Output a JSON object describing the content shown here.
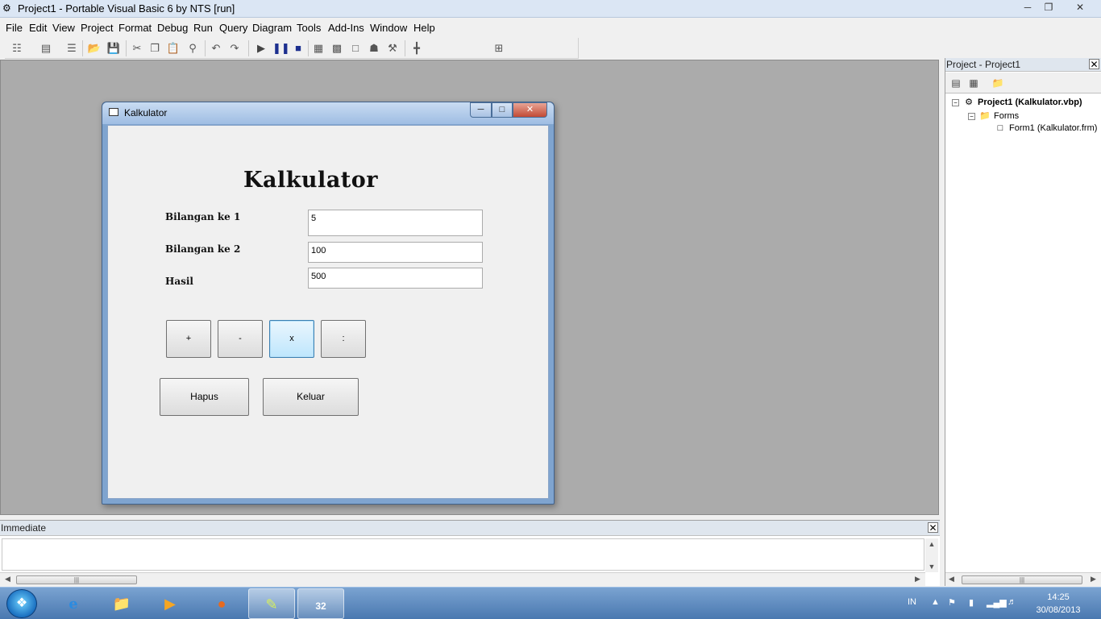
{
  "window": {
    "title": "Project1 - Portable Visual Basic 6 by NTS [run]"
  },
  "menu": [
    "File",
    "Edit",
    "View",
    "Project",
    "Format",
    "Debug",
    "Run",
    "Query",
    "Diagram",
    "Tools",
    "Add-Ins",
    "Window",
    "Help"
  ],
  "toolbar_icons": [
    "add-project-icon",
    "add-form-icon",
    "menu-editor-icon",
    "open-project-icon",
    "save-project-icon",
    "cut-icon",
    "copy-icon",
    "paste-icon",
    "find-icon",
    "undo-icon",
    "redo-icon",
    "start-icon",
    "break-icon",
    "end-icon",
    "project-explorer-icon",
    "properties-window-icon",
    "form-layout-icon",
    "object-browser-icon",
    "toolbox-icon",
    "data-view-icon",
    "position-readout-icon"
  ],
  "form": {
    "caption": "Kalkulator",
    "heading": "Kalkulator",
    "fields": [
      {
        "label": "Bilangan ke 1",
        "value": "5"
      },
      {
        "label": "Bilangan ke 2",
        "value": "100"
      },
      {
        "label": "Hasil",
        "value": "500"
      }
    ],
    "operators": [
      "+",
      "-",
      "x",
      ":"
    ],
    "active_operator": "x",
    "buttons": {
      "clear": "Hapus",
      "exit": "Keluar"
    }
  },
  "project_panel": {
    "title": "Project - Project1",
    "tree": {
      "project": "Project1 (Kalkulator.vbp)",
      "folder": "Forms",
      "form": "Form1 (Kalkulator.frm)"
    }
  },
  "immediate": {
    "title": "Immediate"
  },
  "taskbar": {
    "apps": [
      "internet-explorer-icon",
      "file-explorer-icon",
      "media-player-icon",
      "firefox-icon",
      "pen-tool-icon",
      "vb6-icon"
    ],
    "language": "IN",
    "time": "14:25",
    "date": "30/08/2013"
  },
  "colors": {
    "mdi_background": "#ababab",
    "taskbar": "#4a78b0",
    "form_border": "#7fa4cf"
  }
}
